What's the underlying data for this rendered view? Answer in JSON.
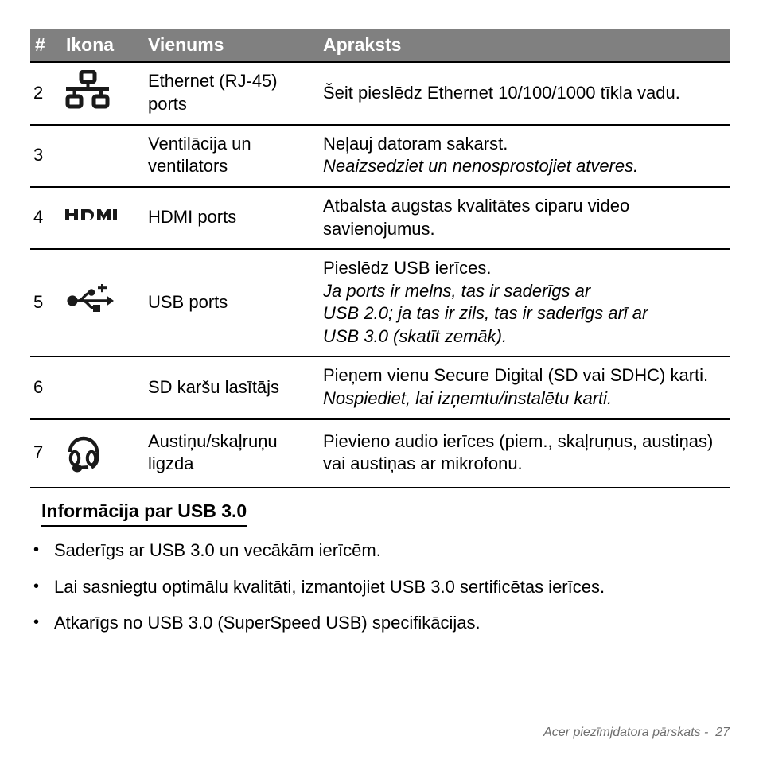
{
  "table": {
    "columns": [
      "#",
      "Ikona",
      "Vienums",
      "Apraksts"
    ],
    "header_bg": "#808080",
    "header_color": "#ffffff",
    "rows": [
      {
        "num": "2",
        "icon": "ethernet-icon",
        "item": "Ethernet (RJ-45) ports",
        "desc": [
          {
            "text": "Šeit pieslēdz Ethernet 10/100/1000 tīkla vadu.",
            "italic": false
          }
        ]
      },
      {
        "num": "3",
        "icon": "",
        "item": "Ventilācija un ventilators",
        "desc": [
          {
            "text": "Neļauj datoram sakarst.",
            "italic": false
          },
          {
            "text": "Neaizsedziet un nenosprostojiet atveres.",
            "italic": true
          }
        ]
      },
      {
        "num": "4",
        "icon": "hdmi-icon",
        "item": "HDMI ports",
        "desc": [
          {
            "text": "Atbalsta augstas kvalitātes ciparu video savienojumus.",
            "italic": false
          }
        ]
      },
      {
        "num": "5",
        "icon": "usb-icon",
        "item": "USB ports",
        "desc": [
          {
            "text": "Pieslēdz USB ierīces.",
            "italic": false
          },
          {
            "text": "Ja ports ir melns, tas ir saderīgs ar",
            "italic": true
          },
          {
            "text": "USB 2.0; ja tas ir zils, tas ir saderīgs arī ar",
            "italic": true
          },
          {
            "text": "USB 3.0 (skatīt zemāk).",
            "italic": true
          }
        ]
      },
      {
        "num": "6",
        "icon": "",
        "item": "SD karšu lasītājs",
        "desc": [
          {
            "text": "Pieņem vienu Secure Digital (SD vai SDHC) karti.",
            "italic": false
          },
          {
            "text": "Nospiediet, lai izņemtu/instalētu karti.",
            "italic": true
          }
        ]
      },
      {
        "num": "7",
        "icon": "headset-icon",
        "item": "Austiņu/skaļruņu ligzda",
        "desc": [
          {
            "text": "Pievieno audio ierīces (piem., skaļruņus, austiņas) vai austiņas ar mikrofonu.",
            "italic": false
          }
        ]
      }
    ]
  },
  "section": {
    "heading": "Informācija par USB 3.0",
    "bullet_char": "•",
    "bullets": [
      "Saderīgs ar USB 3.0 un vecākām ierīcēm.",
      "Lai sasniegtu optimālu kvalitāti, izmantojiet USB 3.0 sertificētas ierīces.",
      "Atkarīgs no USB 3.0 (SuperSpeed USB) specifikācijas."
    ]
  },
  "footer": {
    "text": "Acer piezīmjdatora pārskats -  27"
  }
}
